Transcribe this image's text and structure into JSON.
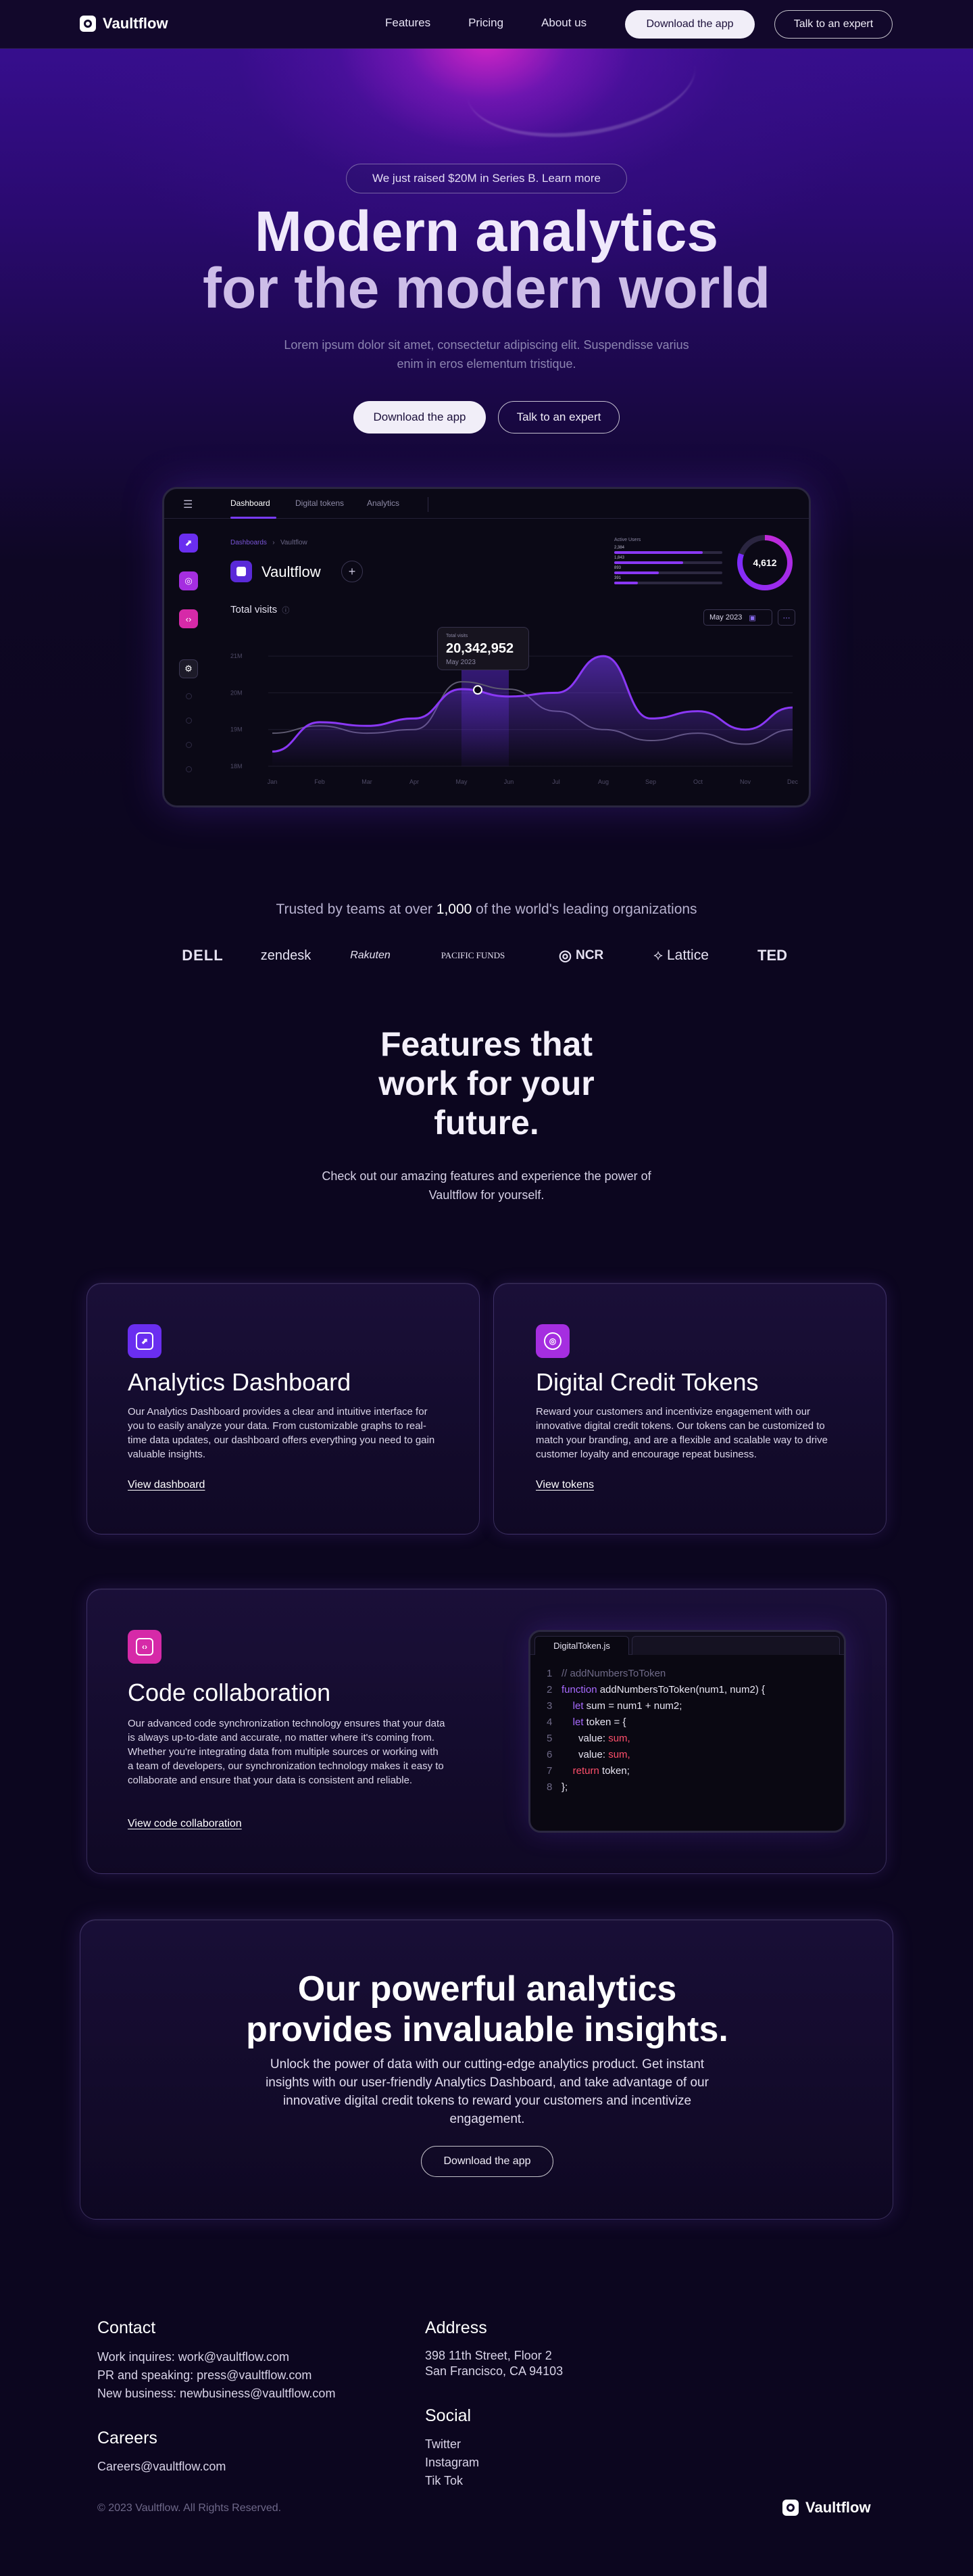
{
  "nav": {
    "brand": "Vaultflow",
    "links": [
      "Features",
      "Pricing",
      "About us"
    ],
    "download_label": "Download the app",
    "talk_label": "Talk to an expert"
  },
  "hero": {
    "announcement": "We just raised $20M in Series B. Learn more",
    "title_line1": "Modern analytics",
    "title_line2": "for the modern world",
    "subtitle": "Lorem ipsum dolor sit amet, consectetur adipiscing elit. Suspendisse varius enim in eros elementum tristique.",
    "download_label": "Download the app",
    "talk_label": "Talk to an expert"
  },
  "dashboard": {
    "tabs": [
      "Dashboard",
      "Digital tokens",
      "Analytics"
    ],
    "breadcrumb_root": "Dashboards",
    "breadcrumb_current": "Vaultflow",
    "brand": "Vaultflow",
    "plus": "+",
    "section_title": "Total visits",
    "stats_label": "Active Users",
    "stat_rows": [
      {
        "label": "2,384",
        "fill": 0.82
      },
      {
        "label": "1,843",
        "fill": 0.64
      },
      {
        "label": "893",
        "fill": 0.41
      },
      {
        "label": "391",
        "fill": 0.22
      }
    ],
    "ring_value": "4,612",
    "ring_fill": 0.8,
    "date_select": "May 2023",
    "tooltip_label": "Total visits",
    "tooltip_value": "20,342,952",
    "tooltip_date": "May 2023",
    "colors": {
      "accent": "#7a3cff",
      "pink": "#c22ad8"
    }
  },
  "chart_data": {
    "type": "line",
    "x": [
      "Jan",
      "Feb",
      "Mar",
      "Apr",
      "May",
      "Jun",
      "Jul",
      "Aug",
      "Sep",
      "Oct",
      "Nov",
      "Dec"
    ],
    "y_ticks": [
      "18M",
      "19M",
      "20M",
      "21M"
    ],
    "ylim": [
      18,
      21.5
    ],
    "series": [
      {
        "values": [
          18.4,
          19.2,
          19.1,
          19.3,
          20.1,
          19.9,
          20.0,
          21.0,
          19.3,
          19.5,
          19.0,
          19.6
        ]
      },
      {
        "values": [
          18.9,
          19.1,
          18.9,
          19.0,
          20.3,
          20.1,
          19.5,
          19.0,
          18.7,
          18.9,
          18.6,
          19.0
        ]
      }
    ],
    "highlight_index": 4
  },
  "trusted": {
    "prefix": "Trusted by teams at over",
    "count": "1,000",
    "suffix": "of the world's leading organizations",
    "logos": [
      "DELL",
      "zendesk",
      "Rakuten",
      "PACIFIC FUNDS",
      "NCR",
      "Lattice",
      "TED"
    ]
  },
  "features": {
    "title_l1": "Features that",
    "title_l2": "work for your",
    "title_l3": "future.",
    "subtitle": "Check out our amazing features and experience the power of Vaultflow for yourself.",
    "cards": [
      {
        "title": "Analytics Dashboard",
        "text": "Our Analytics Dashboard provides a clear and intuitive interface for you to easily analyze your data. From customizable graphs to real-time data updates, our dashboard offers everything you need to gain valuable insights.",
        "link": "View dashboard",
        "icon_color": "#6a2ef0"
      },
      {
        "title": "Digital Credit Tokens",
        "text": "Reward your customers and incentivize engagement with our innovative digital credit tokens. Our tokens can be customized to match your branding, and are a flexible and scalable way to drive customer loyalty and encourage repeat business.",
        "link": "View tokens",
        "icon_color": "#a52ee0"
      },
      {
        "title": "Code collaboration",
        "text": "Our advanced code synchronization technology ensures that your data is always up-to-date and accurate, no matter where it's coming from. Whether you're integrating data from multiple sources or working with a team of developers, our synchronization technology makes it easy to collaborate and ensure that your data is consistent and reliable.",
        "link": "View code collaboration",
        "icon_color": "#d62aa8"
      }
    ]
  },
  "code": {
    "filename": "DigitalToken.js",
    "lines": [
      {
        "n": "1",
        "a": "// addNumbersToToken",
        "b": "",
        "c": ""
      },
      {
        "n": "2",
        "a": "function",
        "b": " addNumbersToToken(num1, num2) {",
        "c": ""
      },
      {
        "n": "3",
        "a": "    let",
        "b": " sum = num1 + num2;",
        "c": ""
      },
      {
        "n": "4",
        "a": "    let",
        "b": " token = {",
        "c": ""
      },
      {
        "n": "5",
        "a": "",
        "b": "      value: ",
        "c": "sum,"
      },
      {
        "n": "6",
        "a": "",
        "b": "      value: ",
        "c": "sum,"
      },
      {
        "n": "7",
        "a": "    return",
        "b": " token;",
        "c": ""
      },
      {
        "n": "8",
        "a": "",
        "b": "};",
        "c": ""
      }
    ]
  },
  "cta": {
    "title_l1": "Our powerful analytics",
    "title_l2": "provides invaluable insights.",
    "text": "Unlock the power of data with our cutting-edge analytics product. Get instant insights with our user-friendly Analytics Dashboard, and take advantage of our innovative digital credit tokens to reward your customers and incentivize engagement.",
    "button": "Download the app"
  },
  "footer": {
    "contact_h": "Contact",
    "contact": [
      "Work inquires: work@vaultflow.com",
      "PR and speaking: press@vaultflow.com",
      "New business: newbusiness@vaultflow.com"
    ],
    "careers_h": "Careers",
    "careers": "Careers@vaultflow.com",
    "address_h": "Address",
    "address": [
      "398 11th Street, Floor 2",
      "San Francisco, CA 94103"
    ],
    "social_h": "Social",
    "social": [
      "Twitter",
      "Instagram",
      "Tik Tok"
    ],
    "copyright": "© 2023 Vaultflow. All Rights Reserved.",
    "brand": "Vaultflow"
  }
}
